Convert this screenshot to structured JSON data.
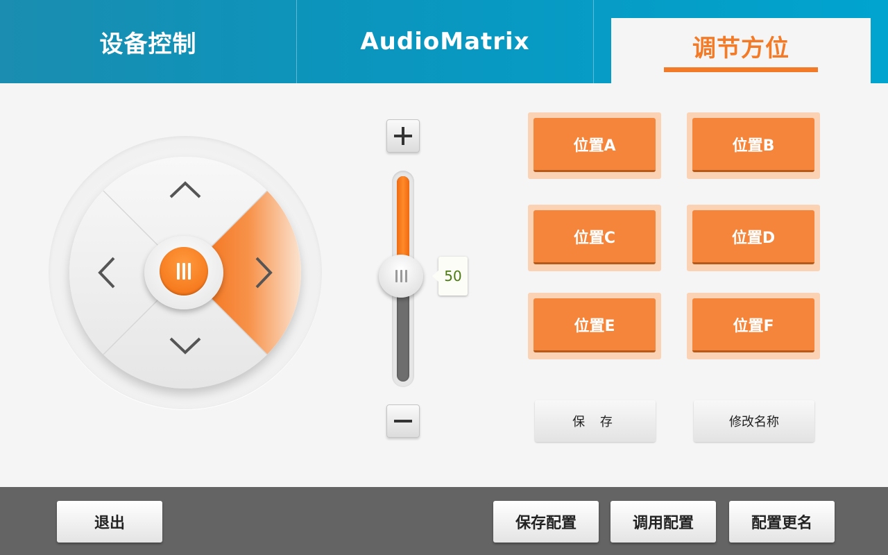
{
  "tabs": [
    {
      "label": "设备控制",
      "active": false
    },
    {
      "label": "AudioMatrix",
      "active": false
    },
    {
      "label": "调节方位",
      "active": true
    }
  ],
  "colors": {
    "accent": "#f37a26",
    "header": "#0b95bd",
    "bottom_bar": "#646464",
    "preset_fill": "#f5853a",
    "tooltip_text": "#4c7a13"
  },
  "direction_pad": {
    "up_icon": "chevron-up-icon",
    "down_icon": "chevron-down-icon",
    "left_icon": "chevron-left-icon",
    "right_icon": "chevron-right-icon",
    "center_icon": "grip-icon",
    "highlighted": "right"
  },
  "slider": {
    "value": "50",
    "min": 0,
    "max": 100,
    "fraction": 0.5,
    "plus_icon": "plus-icon",
    "minus_icon": "minus-icon"
  },
  "presets": [
    "位置A",
    "位置B",
    "位置C",
    "位置D",
    "位置E",
    "位置F"
  ],
  "actions": {
    "save_label": "保 存",
    "rename_label": "修改名称"
  },
  "bottom_bar": {
    "exit_label": "退出",
    "save_config_label": "保存配置",
    "load_config_label": "调用配置",
    "rename_config_label": "配置更名"
  }
}
